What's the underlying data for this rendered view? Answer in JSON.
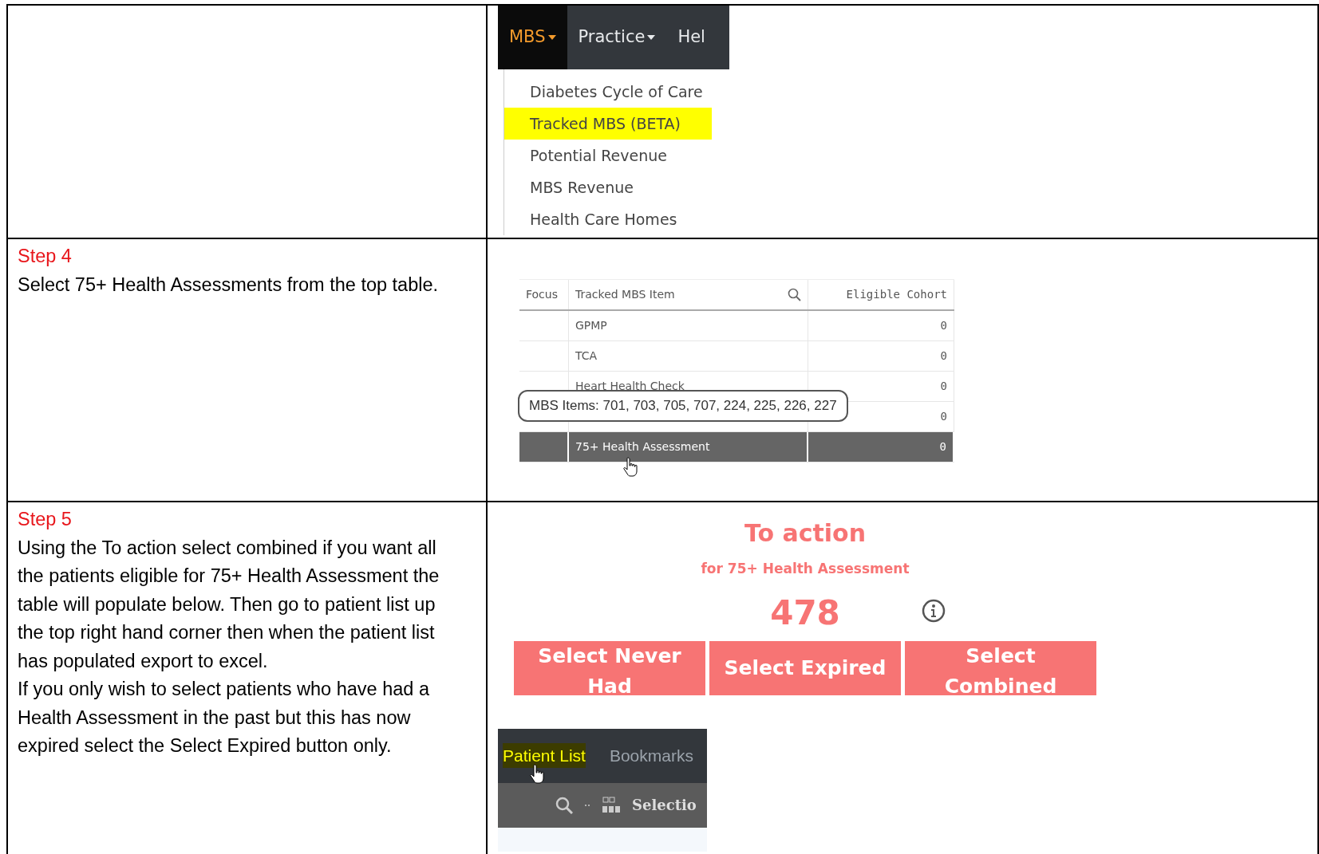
{
  "steps": [
    {
      "kind": "menu",
      "nav": [
        {
          "label": "MBS",
          "selected": true
        },
        {
          "label": "Practice",
          "selected": false
        },
        {
          "label": "Hel",
          "selected": false
        }
      ],
      "items": [
        {
          "label": "Diabetes Cycle of Care",
          "selected": false
        },
        {
          "label": "Tracked MBS (BETA)",
          "selected": true
        },
        {
          "label": "Potential Revenue",
          "selected": false
        },
        {
          "label": "MBS Revenue",
          "selected": false
        },
        {
          "label": "Health Care Homes",
          "selected": false
        }
      ]
    },
    {
      "kind": "table",
      "title": "Step 4",
      "lines": [
        "Select 75+ Health Assessments from the top table."
      ],
      "columns": [
        "Focus",
        "Tracked MBS Item",
        "Eligible Cohort"
      ],
      "rows": [
        {
          "item": "GPMP",
          "cohort": "0",
          "selected": false
        },
        {
          "item": "TCA",
          "cohort": "0",
          "selected": false
        },
        {
          "item": "Heart Health Check",
          "cohort": "0",
          "selected": false
        },
        {
          "cohort": "0",
          "selected": false
        },
        {
          "item": "75+ Health Assessment",
          "cohort": "0",
          "selected": true
        }
      ],
      "tooltip": "MBS Items: 701, 703, 705, 707, 224, 225, 226, 227"
    },
    {
      "kind": "action",
      "title": "Step 5",
      "lines": [
        "Using the To action select combined if you want all the patients eligible for 75+ Health Assessment the table will populate below. Then go to patient list up the top right hand corner then when the patient list has populated export to excel.",
        "If you only wish to select patients who have had a Health Assessment in the past but this has now expired select the Select Expired button only."
      ],
      "heading": "To action",
      "subheading": "for 75+ Health Assessment",
      "count": "478",
      "buttons": [
        "Select Never Had",
        "Select Expired",
        "Select Combined"
      ],
      "tabs": [
        {
          "label": "Patient List",
          "selected": true
        },
        {
          "label": "Bookmarks",
          "selected": false
        }
      ],
      "toolbar_label": "Selectio"
    }
  ]
}
